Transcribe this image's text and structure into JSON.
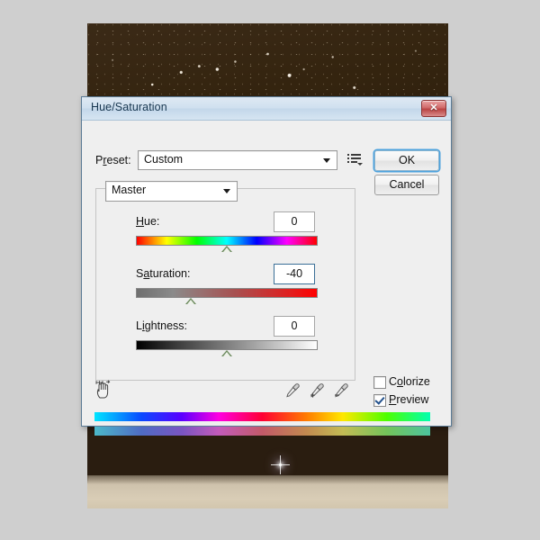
{
  "window": {
    "title": "Hue/Saturation",
    "close_label": "✕",
    "close_icon": "close-icon"
  },
  "preset": {
    "label": "Preset:",
    "label_prefix": "P",
    "label_underlined": "r",
    "label_suffix": "eset:",
    "value": "Custom",
    "options_icon": "preset-options-icon"
  },
  "buttons": {
    "ok": "OK",
    "cancel": "Cancel"
  },
  "channel": {
    "value": "Master"
  },
  "sliders": [
    {
      "id": "hue",
      "label_prefix": "",
      "label_underlined": "H",
      "label_suffix": "ue:",
      "label": "Hue:",
      "value": "0",
      "marker_percent": 50,
      "focused": false
    },
    {
      "id": "saturation",
      "label_prefix": "S",
      "label_underlined": "a",
      "label_suffix": "turation:",
      "label": "Saturation:",
      "value": "-40",
      "marker_percent": 30,
      "focused": true
    },
    {
      "id": "lightness",
      "label_prefix": "L",
      "label_underlined": "i",
      "label_suffix": "ghtness:",
      "label": "Lightness:",
      "value": "0",
      "marker_percent": 50,
      "focused": false
    }
  ],
  "tools": {
    "hand_icon": "hand-icon",
    "eyedropper_icon": "eyedropper-icon",
    "eyedropper_add_icon": "eyedropper-add-icon",
    "eyedropper_subtract_icon": "eyedropper-subtract-icon"
  },
  "checkboxes": [
    {
      "id": "colorize",
      "label": "Colorize",
      "label_prefix": "C",
      "label_underlined": "o",
      "label_suffix": "lorize",
      "checked": false
    },
    {
      "id": "preview",
      "label": "Preview",
      "label_prefix": "",
      "label_underlined": "P",
      "label_suffix": "review",
      "checked": true
    }
  ],
  "spectrum": {
    "top_name": "original-hue-spectrum",
    "bottom_name": "adjusted-hue-spectrum"
  },
  "colors": {
    "dialog_bg": "#efefef",
    "titlebar": "#cfe0ef",
    "accent": "#4da2dd",
    "close_red": "#b94343",
    "marker": "#6c8a5e",
    "check": "#23518c"
  }
}
